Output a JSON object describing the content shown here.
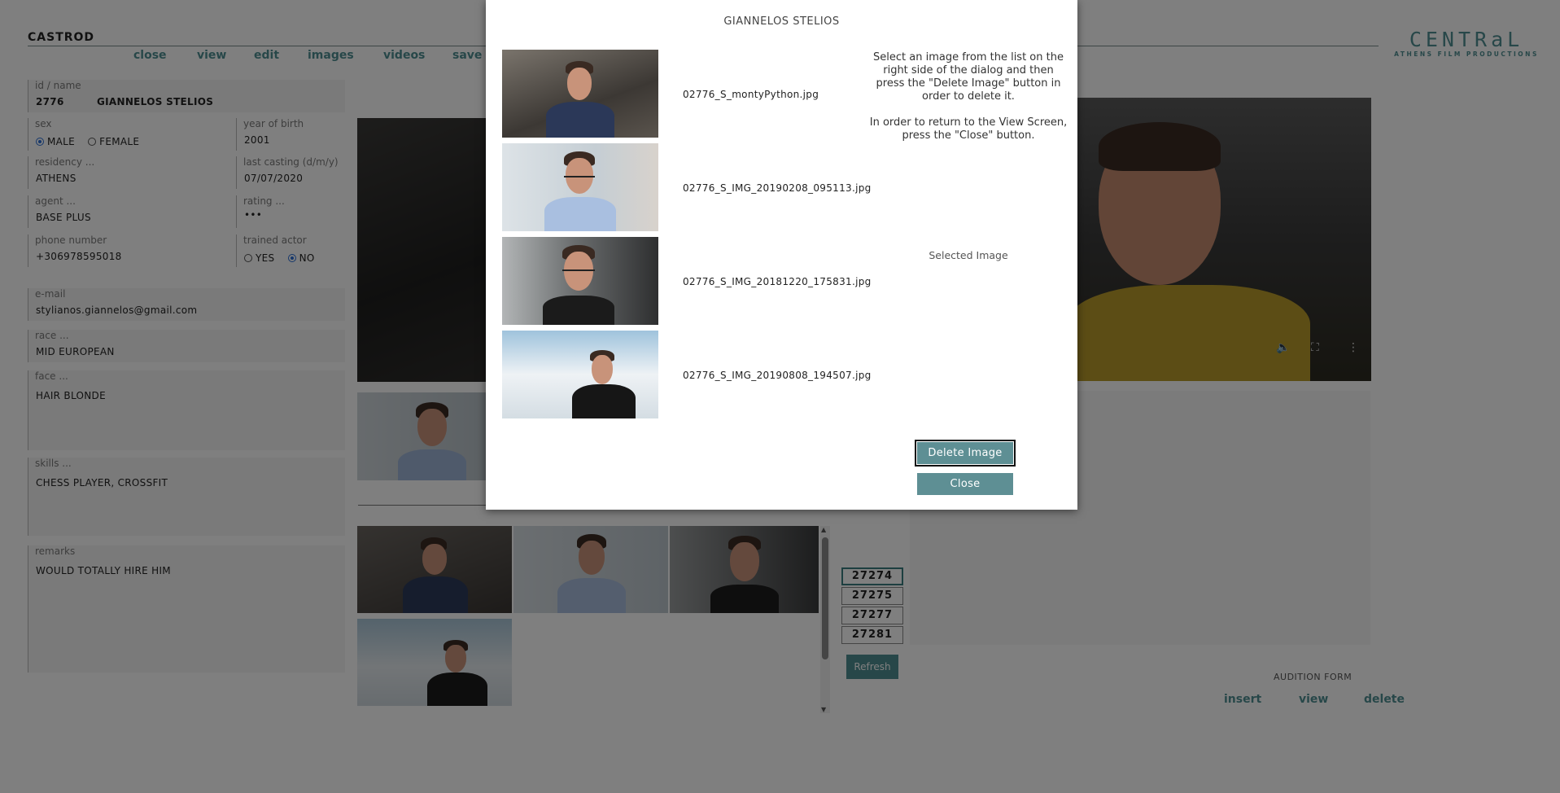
{
  "app": {
    "title": "CASTROD",
    "brand_main": "CENTRaL",
    "brand_sub": "ATHENS FILM PRODUCTIONS",
    "nav": [
      "close",
      "view",
      "edit",
      "images",
      "videos",
      "save"
    ]
  },
  "form": {
    "id_label": "id / name",
    "id_value": "2776",
    "name_value": "GIANNELOS STELIOS",
    "sex_label": "sex",
    "sex_options": [
      "MALE",
      "FEMALE"
    ],
    "sex_selected": "MALE",
    "yob_label": "year of birth",
    "yob_value": "2001",
    "residency_label": "residency ...",
    "residency_value": "ATHENS",
    "last_casting_label": "last casting (d/m/y)",
    "last_casting_value": "07/07/2020",
    "agent_label": "agent ...",
    "agent_value": "BASE PLUS",
    "rating_label": "rating ...",
    "rating_value": "•••",
    "phone_label": "phone number",
    "phone_value": "+306978595018",
    "trained_label": "trained actor",
    "trained_options": [
      "YES",
      "NO"
    ],
    "trained_selected": "NO",
    "email_label": "e-mail",
    "email_value": "stylianos.giannelos@gmail.com",
    "race_label": "race ...",
    "race_value": "MID EUROPEAN",
    "face_label": "face ...",
    "face_value": "HAIR BLONDE",
    "skills_label": "skills ...",
    "skills_value": "CHESS PLAYER, CROSSFIT",
    "remarks_label": "remarks",
    "remarks_value": "WOULD TOTALLY HIRE HIM"
  },
  "image_ids": [
    "27274",
    "27275",
    "27277",
    "27281"
  ],
  "refresh_label": "Refresh",
  "audition": {
    "label": "AUDITION FORM",
    "insert": "insert",
    "view": "view",
    "delete": "delete"
  },
  "dialog": {
    "title": "GIANNELOS STELIOS",
    "instructions_1": "Select an image from the list on the right side of the dialog and then press the \"Delete Image\" button in order to delete it.",
    "instructions_2": "In order to return to the View Screen, press the \"Close\" button.",
    "selected_label": "Selected Image",
    "files": [
      "02776_S_montyPython.jpg",
      "02776_S_IMG_20190208_095113.jpg",
      "02776_S_IMG_20181220_175831.jpg",
      "02776_S_IMG_20190808_194507.jpg"
    ],
    "delete_label": "Delete Image",
    "close_label": "Close"
  },
  "colors": {
    "accent": "#4f8f92",
    "button": "#5e8f94",
    "overlay": "rgba(0,0,0,0.5)"
  }
}
